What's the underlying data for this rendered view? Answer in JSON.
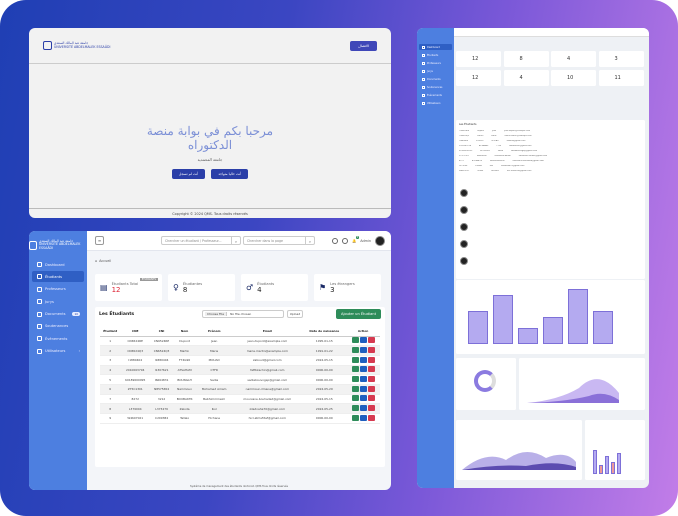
{
  "portal": {
    "logo_text": [
      "جامعة عبد المالك السعدي",
      "UNIVERSITÉ ABDELMALEK ESSAÂDI"
    ],
    "login_button": "الاتصال",
    "title_line1": "مرحبا بكم في بوابة منصة",
    "title_line2": "الدكتوراه",
    "subtitle": "جامعة المحمدية",
    "btn_login": "أنت لم تسجل",
    "btn_register": "أنت حاليا متواجد",
    "footer": "Copyright © 2024 QMS. Tous droits réservés"
  },
  "app": {
    "logo_text": [
      "جامعة عبد المالك السعدي",
      "UNIVERSITÉ ABDELMALEK ESSAÂDI"
    ],
    "nav": [
      {
        "label": "Dashboard",
        "badge": ""
      },
      {
        "label": "Étudiants",
        "badge": ""
      },
      {
        "label": "Professeurs",
        "badge": ""
      },
      {
        "label": "Jurys",
        "badge": ""
      },
      {
        "label": "Documents",
        "badge": "10"
      },
      {
        "label": "Soutenances",
        "badge": ""
      },
      {
        "label": "Évènements",
        "badge": ""
      },
      {
        "label": "Utilisateurs",
        "badge": ""
      }
    ],
    "search1_placeholder": "Chercher un étudiant / Professeur...",
    "search2_placeholder": "Chercher dans la page",
    "notif_count": "3",
    "user": "Admin",
    "breadcrumb": "Accueil",
    "stats": [
      {
        "label": "Étudiants Total",
        "value": "12",
        "badge": "ÉTUDIANTS",
        "icon": "document-icon"
      },
      {
        "label": "Étudiantes",
        "value": "8",
        "badge": "",
        "icon": "female-icon"
      },
      {
        "label": "Étudiants",
        "value": "4",
        "badge": "",
        "icon": "male-icon"
      },
      {
        "label": "Les étrangers",
        "value": "3",
        "badge": "",
        "icon": "flag-icon"
      }
    ],
    "table_title": "Les Étudiants",
    "choose_file": "Choose File",
    "no_file": "No file chosen",
    "upload": "Upload",
    "add_button": "Ajouter un Étudiant",
    "columns": [
      "Étudiant",
      "CNE",
      "CNI",
      "Nom",
      "Prénom",
      "Email",
      "Date de naissance",
      "Action"
    ],
    "rows": [
      [
        "1",
        "CN6524RE",
        "CN6524RE",
        "Dupont",
        "Jean",
        "jean.dupont@example.com",
        "1995-01-15"
      ],
      [
        "2",
        "CN6524Q3",
        "CN6524Q3",
        "Martin",
        "Marie",
        "marie.martin@example.com",
        "1991-01-22"
      ],
      [
        "3",
        "I1880404",
        "I1880404",
        "F74G90",
        "MOUAD",
        "zaboud@gmail.com",
        "2024-05-15"
      ],
      [
        "4",
        "2010063794",
        "I1307621",
        "ATSAHAM",
        "CTFR",
        "fatfbkachin@gmail.com",
        "0000-00-00"
      ],
      [
        "5",
        "K0189000995",
        "I6664831",
        "BOUNGLH",
        "Sadia",
        "sadiabouvngsp@gmail.com",
        "0000-00-00"
      ],
      [
        "6",
        "Z75C1301",
        "N8575654",
        "Nammoun",
        "Mohamed Amam",
        "nammoun.ilmane@gmail.com",
        "2024-05-29"
      ],
      [
        "7",
        "8272",
        "3212",
        "BOUBAKTR",
        "Bebhimmmeim",
        "mouniane.bouhaded@gmail.com",
        "2024-05-15"
      ],
      [
        "8",
        "L379004",
        "L373479",
        "Zaloda",
        "Ikol",
        "ziladnaha70@gmail.com",
        "2024-05-25"
      ],
      [
        "9",
        "W4607021",
        "C209384",
        "Tallalo",
        "Hichane",
        "hicl.atmsfrtaf@gmail.com",
        "0000-00-00"
      ]
    ],
    "pagination": [
      "←",
      "1",
      "→"
    ],
    "footer": "Système de management des étudiants doctorat. QMS Tous droits réservés"
  },
  "dash": {
    "stat_values": [
      "12",
      "8",
      "4",
      "3",
      "12",
      "4",
      "10",
      "11"
    ],
    "chart_values": [
      6,
      9,
      3,
      5,
      10,
      6
    ]
  }
}
